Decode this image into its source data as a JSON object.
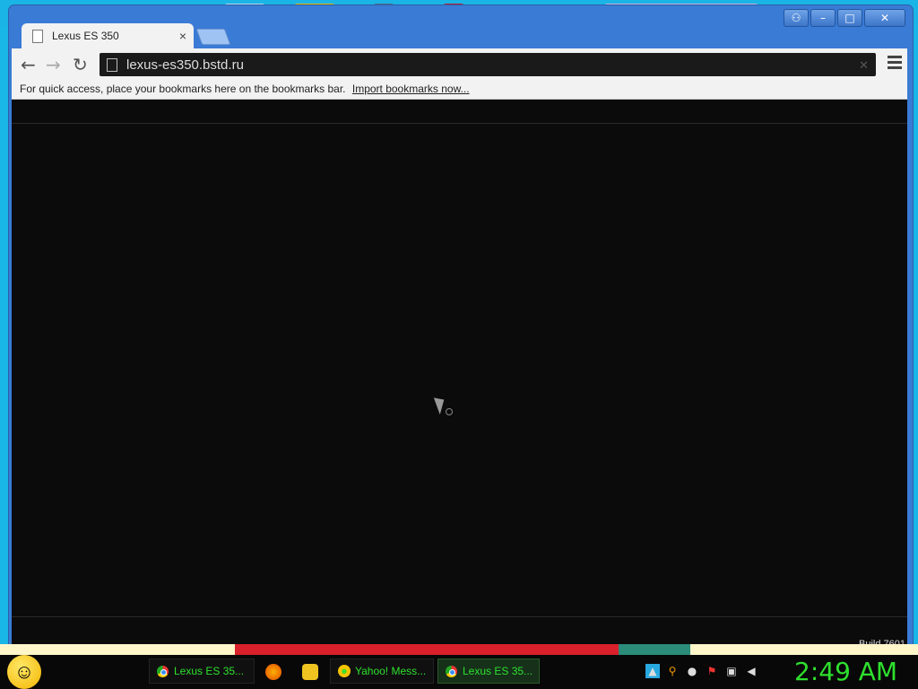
{
  "window": {
    "title_bar_buttons": [
      "user-icon",
      "minimize-icon",
      "maximize-icon",
      "close-icon"
    ],
    "tab": {
      "title": "Lexus ES 350",
      "close": "×"
    }
  },
  "toolbar": {
    "back": "←",
    "forward": "→",
    "reload": "↻",
    "url": "lexus-es350.bstd.ru"
  },
  "bookmarks_bar": {
    "message": "For quick access, place your bookmarks here on the bookmarks bar.",
    "import_link": "Import bookmarks now..."
  },
  "desktop": {
    "build_text": "Build 7601"
  },
  "taskbar": {
    "items": [
      {
        "label": "Lexus ES 35...",
        "icon": "chrome-icon"
      },
      {
        "label": "",
        "icon": "firefox-icon"
      },
      {
        "label": "",
        "icon": "folder-icon"
      },
      {
        "label": "Yahoo! Mess...",
        "icon": "yahoo-icon"
      },
      {
        "label": "Lexus ES 35...",
        "icon": "chrome-icon"
      }
    ],
    "clock": "2:49 AM"
  },
  "colors": {
    "taskbar_text": "#2ee02e",
    "window_frame": "#3a7bd5",
    "content_bg": "#0b0b0b"
  }
}
